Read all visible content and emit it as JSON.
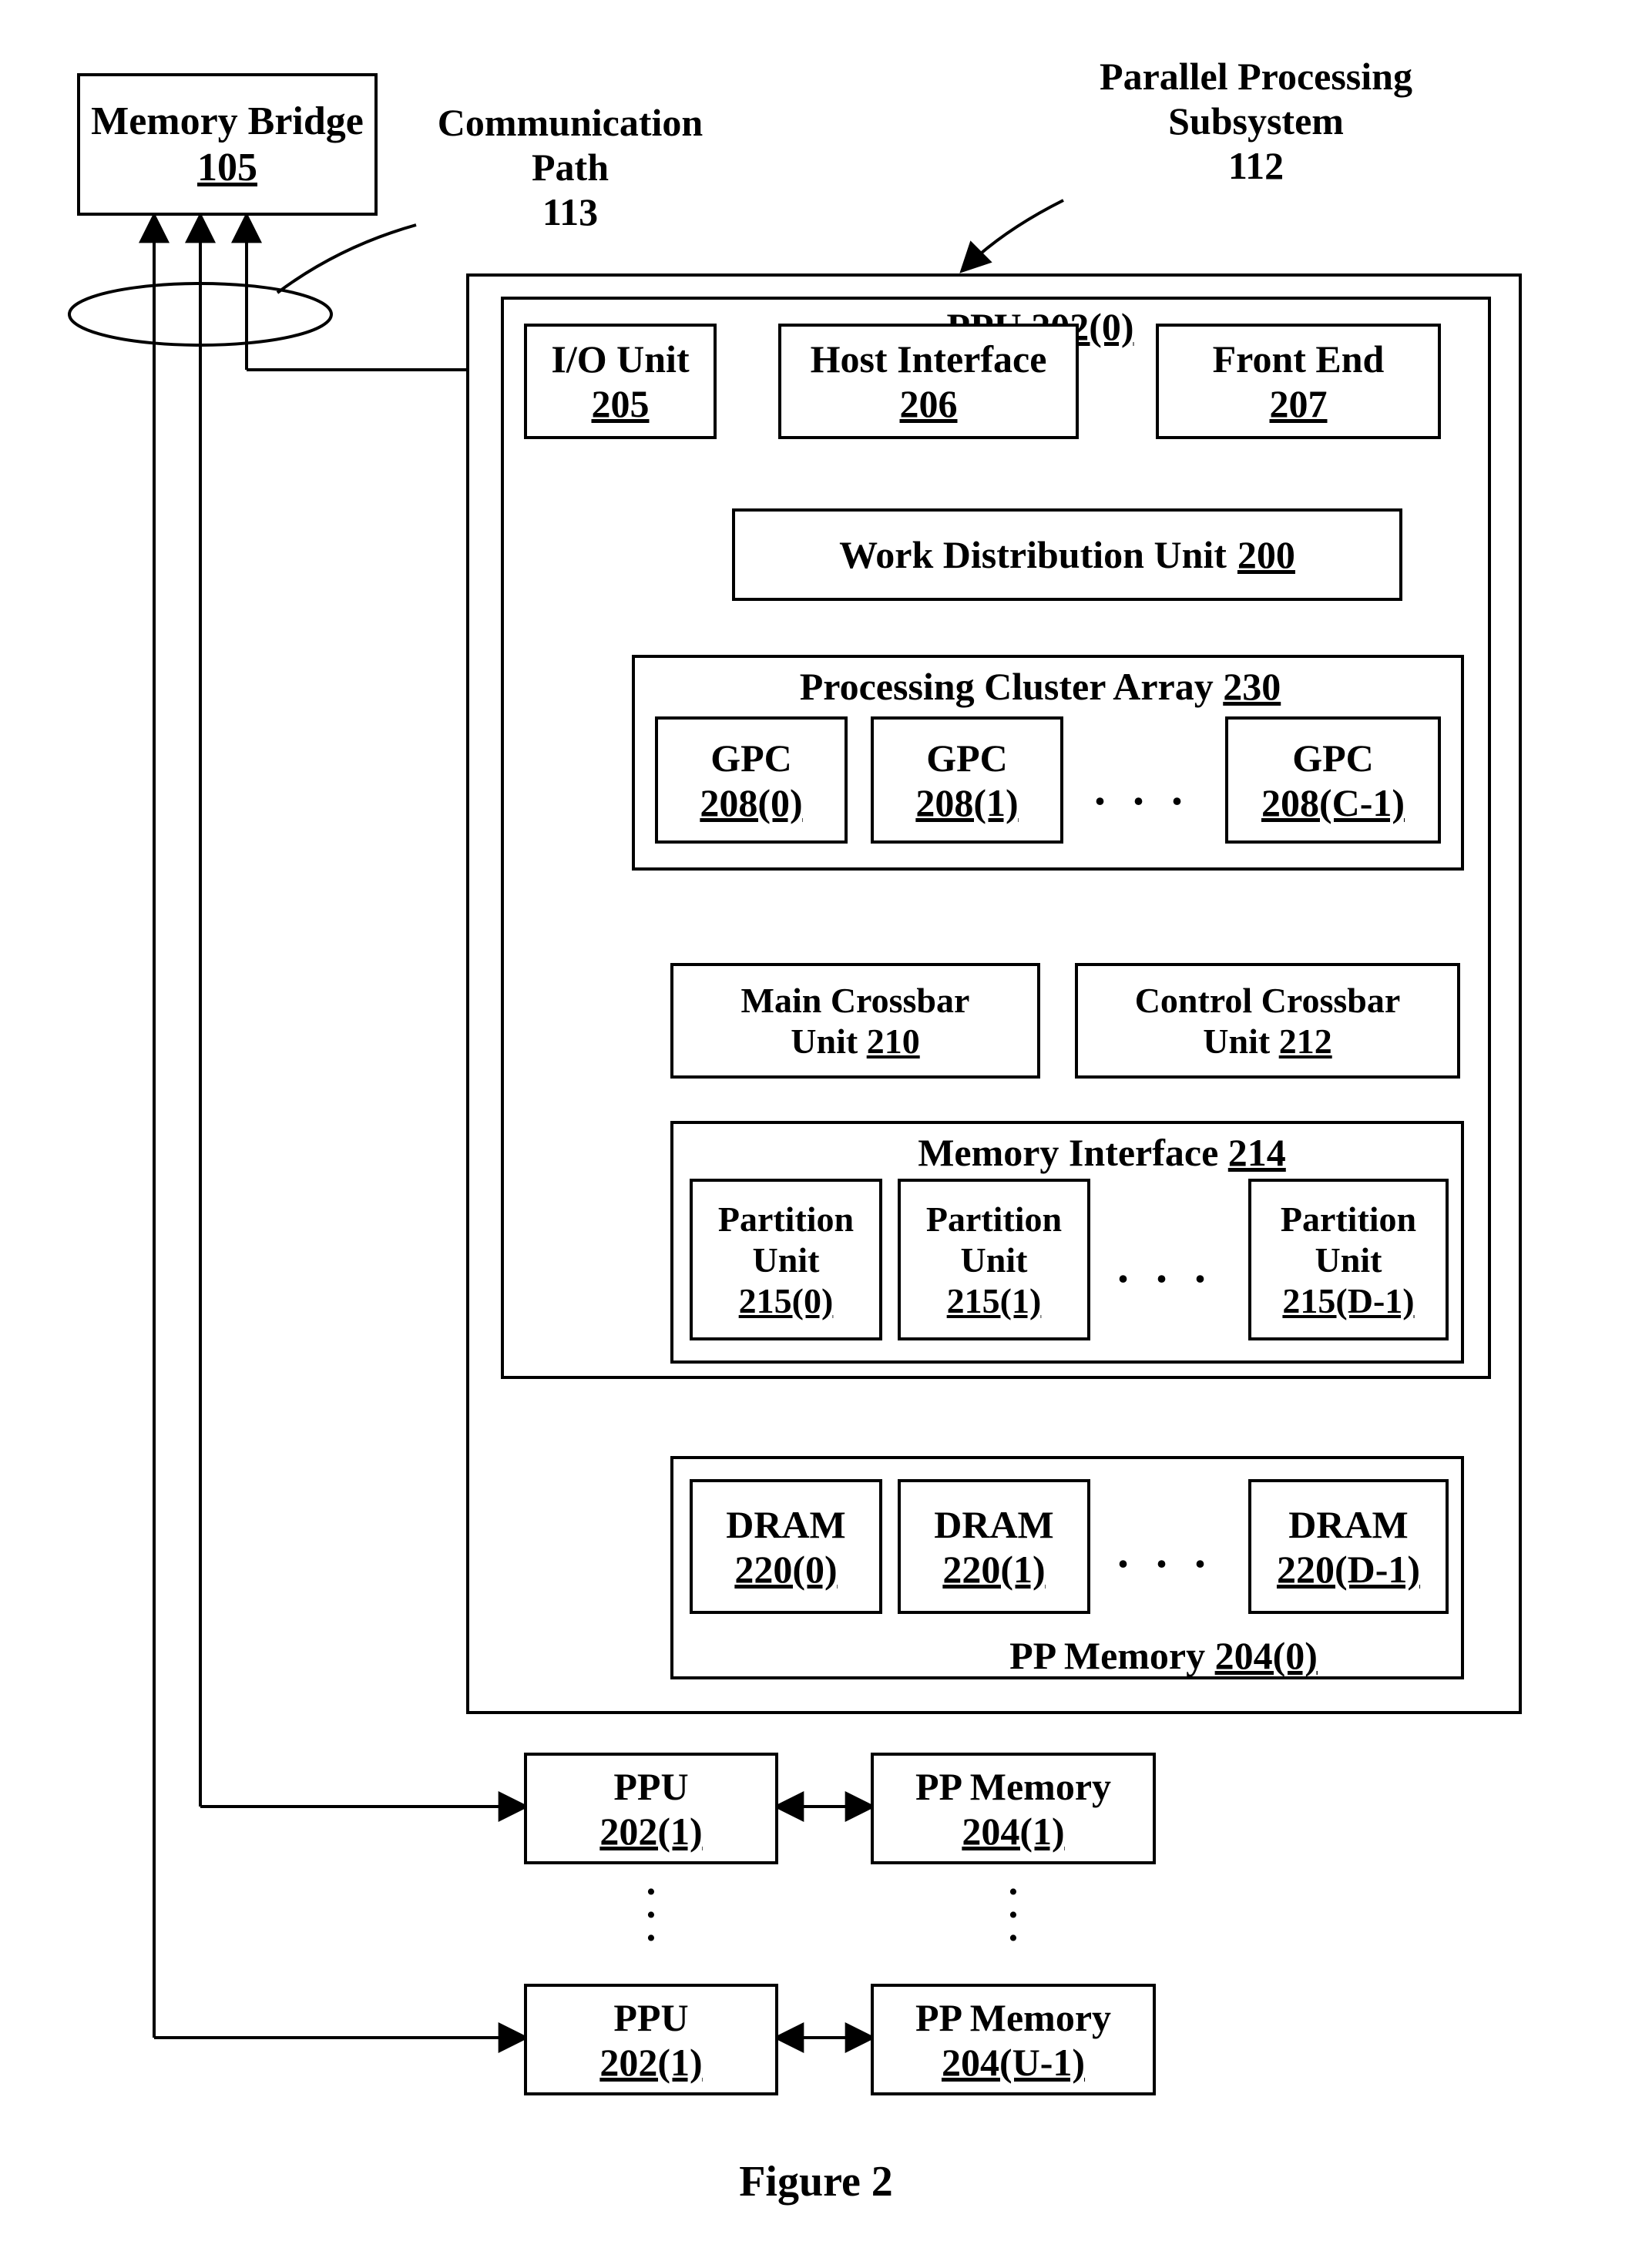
{
  "figure_caption": "Figure 2",
  "memory_bridge": {
    "title": "Memory Bridge",
    "ref": "105"
  },
  "comm_path": {
    "title": "Communication",
    "title2": "Path",
    "ref": "113"
  },
  "pps": {
    "title": "Parallel Processing",
    "title2": "Subsystem",
    "ref": "112"
  },
  "ppu0": {
    "title": "PPU",
    "ref": "202(0)"
  },
  "io_unit": {
    "title": "I/O Unit",
    "ref": "205"
  },
  "host_if": {
    "title": "Host Interface",
    "ref": "206"
  },
  "front_end": {
    "title": "Front End",
    "ref": "207"
  },
  "wdu": {
    "title": "Work Distribution Unit",
    "ref": "200"
  },
  "pca": {
    "title": "Processing Cluster Array",
    "ref": "230"
  },
  "gpc": [
    {
      "title": "GPC",
      "ref": "208(0)"
    },
    {
      "title": "GPC",
      "ref": "208(1)"
    },
    {
      "title": "GPC",
      "ref": "208(C-1)"
    }
  ],
  "main_xbar": {
    "title1": "Main Crossbar",
    "title2": "Unit",
    "ref": "210"
  },
  "ctrl_xbar": {
    "title1": "Control Crossbar",
    "title2": "Unit",
    "ref": "212"
  },
  "mem_if": {
    "title": "Memory Interface",
    "ref": "214"
  },
  "pu": [
    {
      "title1": "Partition",
      "title2": "Unit",
      "ref": "215(0)"
    },
    {
      "title1": "Partition",
      "title2": "Unit",
      "ref": "215(1)"
    },
    {
      "title1": "Partition",
      "title2": "Unit",
      "ref": "215(D-1)"
    }
  ],
  "pp_mem0": {
    "title": "PP Memory",
    "ref": "204(0)"
  },
  "dram": [
    {
      "title": "DRAM",
      "ref": "220(0)"
    },
    {
      "title": "DRAM",
      "ref": "220(1)"
    },
    {
      "title": "DRAM",
      "ref": "220(D-1)"
    }
  ],
  "ppu_extra": [
    {
      "title": "PPU",
      "ref": "202(1)"
    },
    {
      "title": "PPU",
      "ref": "202(1)"
    }
  ],
  "ppmem_extra": [
    {
      "title": "PP Memory",
      "ref": "204(1)"
    },
    {
      "title": "PP Memory",
      "ref": "204(U-1)"
    }
  ],
  "ellipsis": ". . .",
  "vell": "·\n·\n·"
}
